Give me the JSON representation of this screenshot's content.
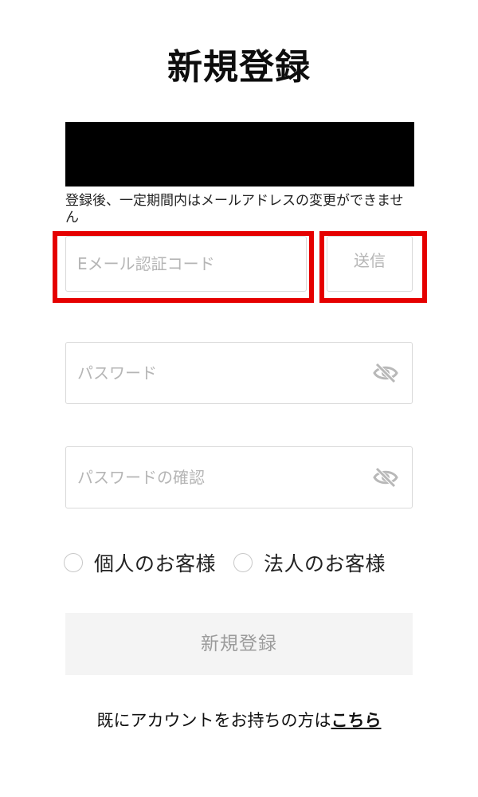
{
  "page": {
    "title": "新規登録"
  },
  "email_section": {
    "note": "登録後、一定期間内はメールアドレスの変更ができません"
  },
  "verification": {
    "code_placeholder": "Eメール認証コード",
    "send_label": "送信"
  },
  "password": {
    "placeholder": "パスワード",
    "toggle_icon": "eye-off-icon"
  },
  "password_confirm": {
    "placeholder": "パスワードの確認",
    "toggle_icon": "eye-off-icon"
  },
  "account_type": {
    "options": [
      {
        "label": "個人のお客様",
        "selected": false
      },
      {
        "label": "法人のお客様",
        "selected": false
      }
    ]
  },
  "submit": {
    "label": "新規登録"
  },
  "login": {
    "prefix": "既にアカウントをお持ちの方は",
    "link_label": "こちら"
  },
  "colors": {
    "highlight": "#e50000",
    "placeholder": "#b5b5b5",
    "disabled_button_bg": "#f4f4f4"
  }
}
